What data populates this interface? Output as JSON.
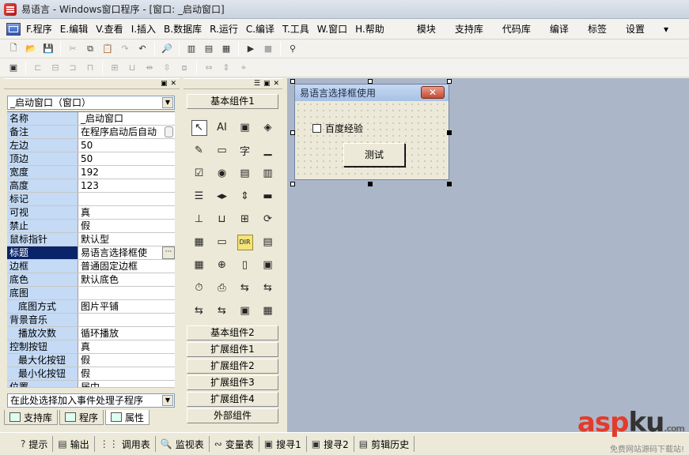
{
  "window": {
    "title": "易语言 - Windows窗口程序 - [窗口: _启动窗口]"
  },
  "menu": {
    "left": [
      "F.程序",
      "E.编辑",
      "V.查看",
      "I.插入",
      "B.数据库",
      "R.运行",
      "C.编译",
      "T.工具",
      "W.窗口",
      "H.帮助"
    ],
    "right": [
      "模块",
      "支持库",
      "代码库",
      "编译",
      "标签",
      "设置",
      "▾"
    ]
  },
  "toolbar1": [
    "new-file-icon",
    "open-folder-icon",
    "save-icon",
    "cut-icon",
    "copy-icon",
    "paste-icon",
    "redo-icon",
    "undo-icon",
    "find-icon",
    "layout1-icon",
    "layout2-icon",
    "layout3-icon",
    "run-icon",
    "stop-icon",
    "binoculars-icon"
  ],
  "properties": {
    "object_combo": "_启动窗口（窗口）",
    "rows": [
      {
        "name": "名称",
        "value": "_启动窗口"
      },
      {
        "name": "备注",
        "value": "在程序启动后自动"
      },
      {
        "name": "左边",
        "value": "50"
      },
      {
        "name": "顶边",
        "value": "50"
      },
      {
        "name": "宽度",
        "value": "192"
      },
      {
        "name": "高度",
        "value": "123"
      },
      {
        "name": "标记",
        "value": ""
      },
      {
        "name": "可视",
        "value": "真"
      },
      {
        "name": "禁止",
        "value": "假"
      },
      {
        "name": "鼠标指针",
        "value": "默认型"
      },
      {
        "name": "标题",
        "value": "易语言选择框使"
      },
      {
        "name": "边框",
        "value": "普通固定边框"
      },
      {
        "name": "底色",
        "value": "默认底色"
      },
      {
        "name": "底图",
        "value": ""
      },
      {
        "name": "底图方式",
        "value": "图片平铺"
      },
      {
        "name": "背景音乐",
        "value": ""
      },
      {
        "name": "播放次数",
        "value": "循环播放"
      },
      {
        "name": "控制按钮",
        "value": "真"
      },
      {
        "name": "最大化按钮",
        "value": "假"
      },
      {
        "name": "最小化按钮",
        "value": "假"
      },
      {
        "name": "位置",
        "value": "居中"
      }
    ],
    "event_combo": "在此处选择加入事件处理子程序"
  },
  "left_tabs": [
    "支持库",
    "程序",
    "属性"
  ],
  "components": {
    "groups_top": [
      "基本组件1"
    ],
    "groups_bottom": [
      "基本组件2",
      "扩展组件1",
      "扩展组件2",
      "扩展组件3",
      "扩展组件4",
      "外部组件"
    ],
    "icons": [
      "↖",
      "AI",
      "▣",
      "◈",
      "✎",
      "▭",
      "字",
      "▁",
      "☑",
      "◉",
      "▤",
      "▥",
      "☰",
      "◂▸",
      "⇕",
      "▬",
      "⊥",
      "⊔",
      "⊞",
      "⟳",
      "▦",
      "▭",
      "DIR",
      "▤",
      "▦",
      "⊕",
      "▯",
      "▣",
      "⏱",
      "⎙",
      "⇆",
      "⇆",
      "⇆",
      "⇆",
      "▣",
      "▦"
    ]
  },
  "design": {
    "form_title": "易语言选择框使用",
    "close_label": "✕",
    "checkbox_label": "百度经验",
    "button_label": "测试"
  },
  "bottom_tabs": [
    {
      "icon": "?",
      "label": "提示"
    },
    {
      "icon": "▤",
      "label": "输出"
    },
    {
      "icon": "⋮⋮",
      "label": "调用表"
    },
    {
      "icon": "🔍",
      "label": "监视表"
    },
    {
      "icon": "∾",
      "label": "变量表"
    },
    {
      "icon": "▣",
      "label": "搜寻1"
    },
    {
      "icon": "▣",
      "label": "搜寻2"
    },
    {
      "icon": "▤",
      "label": "剪辑历史"
    }
  ],
  "watermark": {
    "asp": "asp",
    "ku": "ku",
    "com": ".com",
    "sub": "免费网站源码下载站!"
  }
}
